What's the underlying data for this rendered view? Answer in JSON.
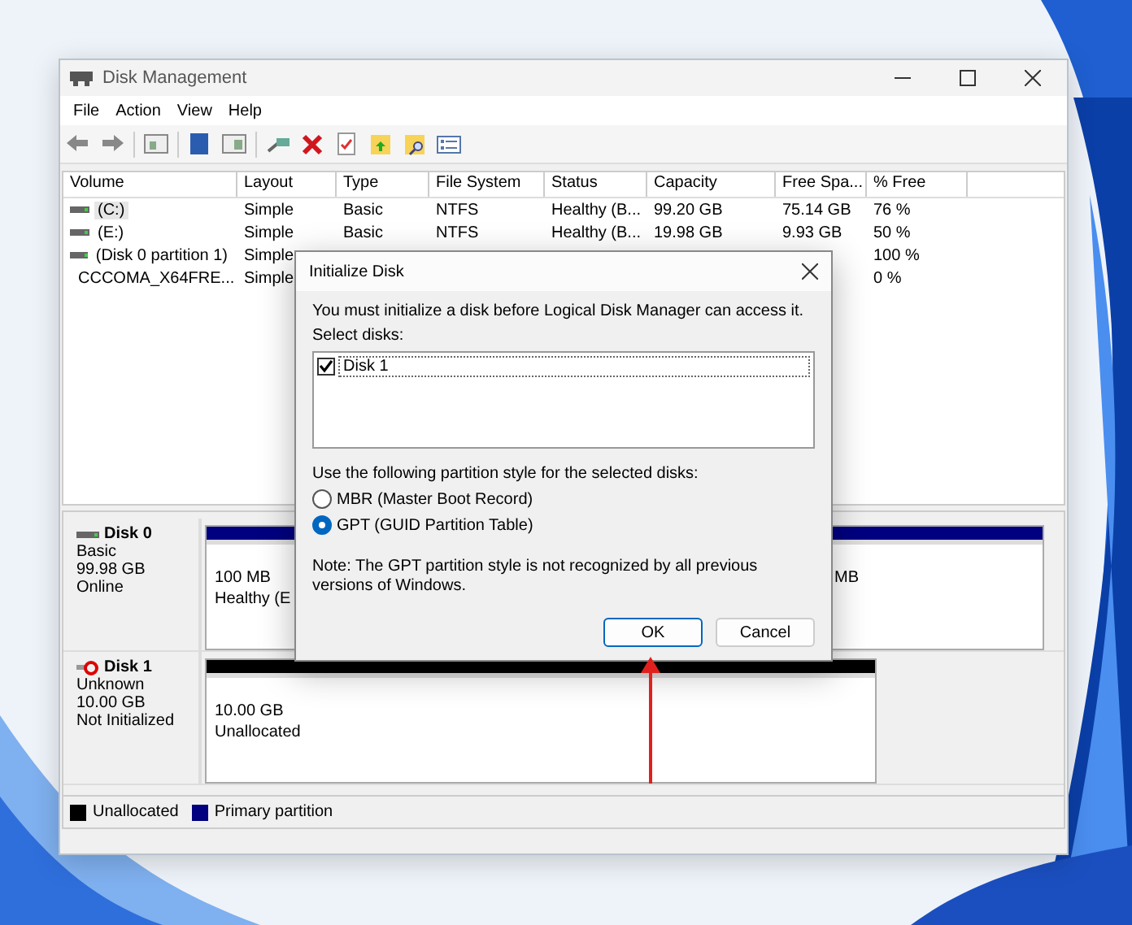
{
  "window": {
    "title": "Disk Management"
  },
  "menu": [
    {
      "label": "File"
    },
    {
      "label": "Action"
    },
    {
      "label": "View"
    },
    {
      "label": "Help"
    }
  ],
  "volumes": {
    "columns": [
      "Volume",
      "Layout",
      "Type",
      "File System",
      "Status",
      "Capacity",
      "Free Spa...",
      "% Free"
    ],
    "rows": [
      {
        "kind": "drive",
        "selected": true,
        "cells": [
          "(C:)",
          "Simple",
          "Basic",
          "NTFS",
          "Healthy (B...",
          "99.20 GB",
          "75.14 GB",
          "76 %"
        ]
      },
      {
        "kind": "drive",
        "selected": false,
        "cells": [
          "(E:)",
          "Simple",
          "Basic",
          "NTFS",
          "Healthy (B...",
          "19.98 GB",
          "9.93 GB",
          "50 %"
        ]
      },
      {
        "kind": "drive",
        "selected": false,
        "cells": [
          "(Disk 0 partition 1)",
          "Simple",
          null,
          null,
          null,
          null,
          null,
          "100 %"
        ]
      },
      {
        "kind": "disc",
        "selected": false,
        "cells": [
          "CCCOMA_X64FRE...",
          "Simple",
          null,
          null,
          null,
          null,
          null,
          "0 %"
        ]
      }
    ]
  },
  "disks": [
    {
      "name": "Disk 0",
      "kind": "online",
      "details": [
        "Basic",
        "99.98 GB",
        "Online"
      ],
      "partitions": [
        {
          "color": "#000080",
          "lines": [
            "100 MB",
            "Healthy (E"
          ]
        },
        {
          "color": "#000080",
          "lines": [
            "MB"
          ]
        }
      ]
    },
    {
      "name": "Disk 1",
      "kind": "not_initialized",
      "details": [
        "Unknown",
        "10.00 GB",
        "Not Initialized"
      ],
      "partitions": [
        {
          "color": "#000000",
          "lines": [
            "10.00 GB",
            "Unallocated"
          ]
        }
      ]
    }
  ],
  "legend": [
    {
      "label": "Unallocated",
      "color": "#000000"
    },
    {
      "label": "Primary partition",
      "color": "#000080"
    }
  ],
  "dialog": {
    "title": "Initialize Disk",
    "message": "You must initialize a disk before Logical Disk Manager can access it.",
    "select_label": "Select disks:",
    "disks": [
      {
        "label": "Disk 1",
        "checked": true
      }
    ],
    "style_label": "Use the following partition style for the selected disks:",
    "styles": [
      {
        "label": "MBR (Master Boot Record)",
        "selected": false
      },
      {
        "label": "GPT (GUID Partition Table)",
        "selected": true
      }
    ],
    "note": "Note: The GPT partition style is not recognized by all previous versions of Windows.",
    "buttons": [
      {
        "label": "OK",
        "default": true
      },
      {
        "label": "Cancel",
        "default": false
      }
    ]
  }
}
